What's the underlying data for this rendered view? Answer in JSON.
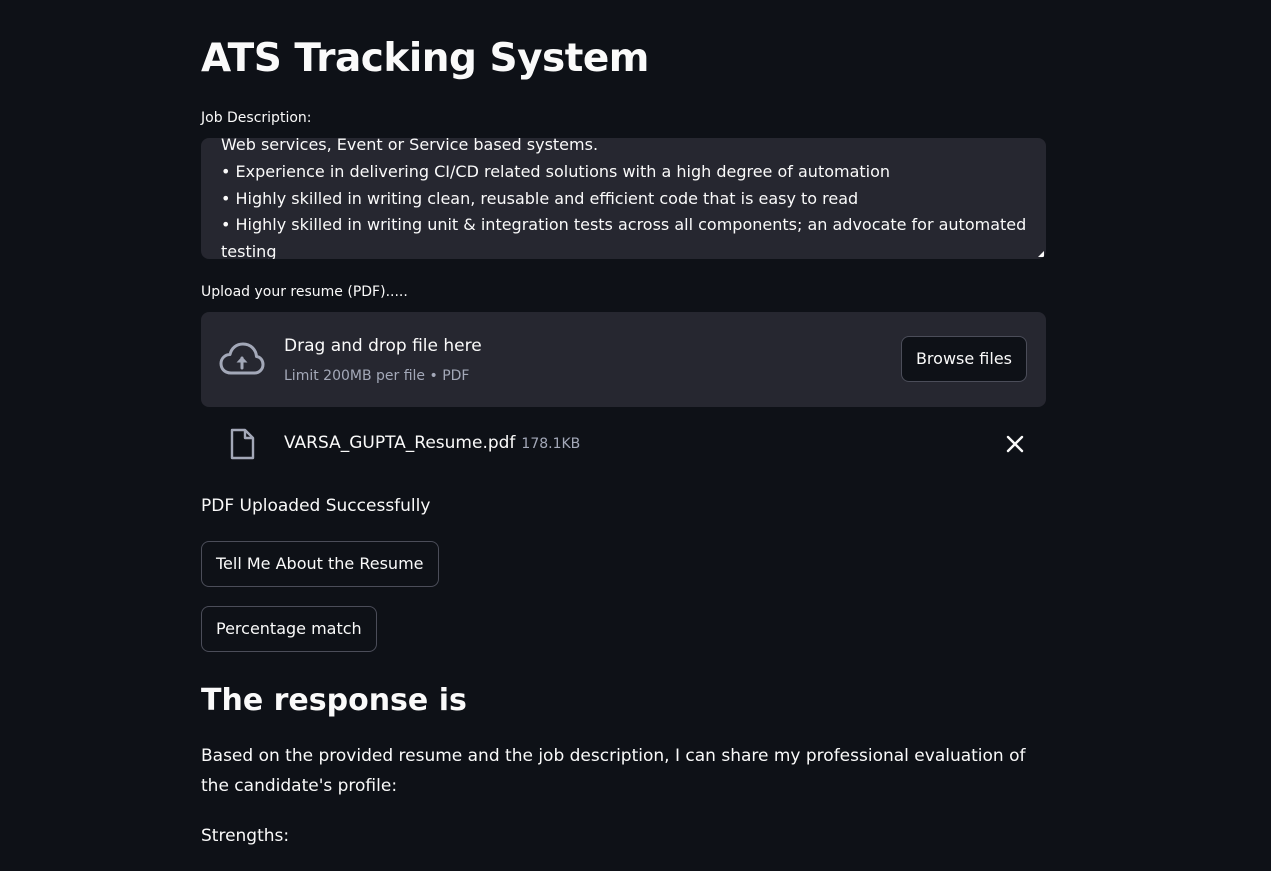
{
  "app": {
    "title": "ATS Tracking System"
  },
  "job_description": {
    "label": "Job Description:",
    "lines": [
      "Web services, Event or Service based systems.",
      "• Experience in delivering CI/CD related solutions with a high degree of automation",
      "• Highly skilled in writing clean, reusable and efficient code that is easy to read",
      "• Highly skilled in writing unit & integration tests across all components; an advocate for automated",
      "testing"
    ]
  },
  "uploader": {
    "label": "Upload your resume (PDF).....",
    "drop_text": "Drag and drop file here",
    "limit_text": "Limit 200MB per file • PDF",
    "browse_label": "Browse files",
    "icon": "cloud-upload-icon"
  },
  "uploaded_file": {
    "name": "VARSA_GUPTA_Resume.pdf",
    "size": "178.1KB",
    "icon": "file-icon",
    "remove_icon": "close-icon"
  },
  "status_text": "PDF Uploaded Successfully",
  "buttons": {
    "tell_me": "Tell Me About the Resume",
    "percentage": "Percentage match"
  },
  "response": {
    "heading": "The response is",
    "intro": "Based on the provided resume and the job description, I can share my professional evaluation of the candidate's profile:",
    "strengths_label": "Strengths:"
  },
  "colors": {
    "background": "#0e1117",
    "surface": "#262730",
    "text": "#fafafa",
    "muted": "#a3a8b8",
    "border": "#4b4d59"
  }
}
